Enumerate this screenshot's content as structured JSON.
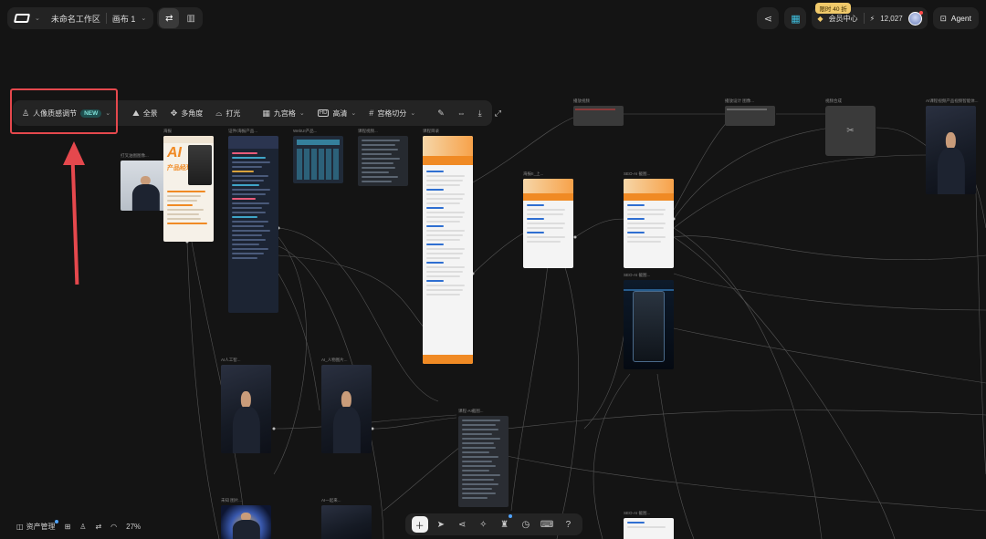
{
  "header": {
    "workspace": "未命名工作区",
    "canvas": "画布 1",
    "promo": "限时 40 折",
    "member_label": "会员中心",
    "points": "12,027",
    "agent_label": "Agent"
  },
  "toolbar": {
    "portrait_label": "人像质感调节",
    "new_badge": "NEW",
    "panorama": "全景",
    "multi_angle": "多角度",
    "lighting": "打光",
    "grid9": "九宫格",
    "hd": "高清",
    "grid_split": "宫格切分"
  },
  "nodes": {
    "n1": "打叉油图图像...",
    "n2": "海报",
    "n3": "证件/海报产品...",
    "n4": "WebUI产品...",
    "n5": "课程视频...",
    "n6": "课程目录",
    "n7": "播放视频",
    "n8": "播放设计 图像...",
    "n9": "视频合成",
    "n10": "AI课程视频产品视频智能体...",
    "n11": "海报II_上...",
    "n12": "SEO-AI 截图...",
    "n13": "SEO-AI 截图...",
    "n14": "AI人工智...",
    "n15": "AI_人物图片...",
    "n16": "课程-AI截图...",
    "n17": "未知 图片...",
    "n18": "AI一起来...",
    "n19": "SEO-AI 截图..."
  },
  "poster": {
    "big_title": "AI",
    "sub_title": "产品经理"
  },
  "bottom": {
    "assets": "资产管理",
    "zoom": "27%"
  },
  "colors": {
    "accent_red": "#e5484d",
    "new_badge": "#7fe0d8",
    "promo_gold": "#f0c96a",
    "orange": "#f08a24"
  }
}
